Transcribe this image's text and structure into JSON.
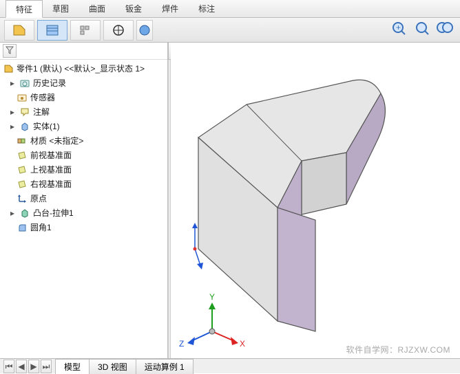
{
  "tabs": [
    "特征",
    "草图",
    "曲面",
    "钣金",
    "焊件",
    "标注"
  ],
  "active_tab": 0,
  "tree": {
    "root": "零件1 (默认) <<默认>_显示状态 1>",
    "items": [
      {
        "label": "历史记录",
        "icon": "history",
        "expandable": true
      },
      {
        "label": "传感器",
        "icon": "sensor",
        "expandable": false
      },
      {
        "label": "注解",
        "icon": "annotation",
        "expandable": true
      },
      {
        "label": "实体(1)",
        "icon": "solid",
        "expandable": true
      },
      {
        "label": "材质 <未指定>",
        "icon": "material",
        "expandable": false
      },
      {
        "label": "前视基准面",
        "icon": "plane",
        "expandable": false
      },
      {
        "label": "上视基准面",
        "icon": "plane",
        "expandable": false
      },
      {
        "label": "右视基准面",
        "icon": "plane",
        "expandable": false
      },
      {
        "label": "原点",
        "icon": "origin",
        "expandable": false
      },
      {
        "label": "凸台-拉伸1",
        "icon": "extrude",
        "expandable": true
      },
      {
        "label": "圆角1",
        "icon": "fillet",
        "expandable": false
      }
    ]
  },
  "bottom_tabs": [
    "模型",
    "3D 视图",
    "运动算例 1"
  ],
  "active_bottom": 0,
  "watermark": "软件自学网：RJZXW.COM"
}
